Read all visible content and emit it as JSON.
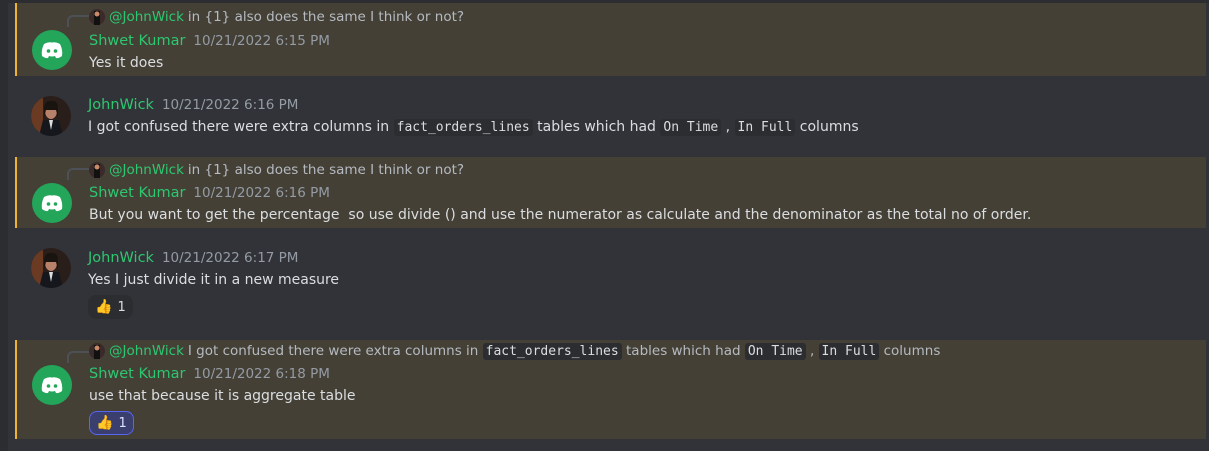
{
  "messages": [
    {
      "reply": {
        "mention": "@JohnWick",
        "text": "in {1} also does the same I think or not?"
      },
      "author": "Shwet Kumar",
      "timestamp": "10/21/2022 6:15 PM",
      "text": "Yes it does"
    },
    {
      "author": "JohnWick",
      "timestamp": "10/21/2022 6:16 PM",
      "parts": [
        "I got confused there were extra columns in",
        "fact_orders_lines",
        "tables which had",
        "On Time",
        ",",
        "In Full",
        "columns"
      ]
    },
    {
      "reply": {
        "mention": "@JohnWick",
        "text": "in {1} also does the same I think or not?"
      },
      "author": "Shwet Kumar",
      "timestamp": "10/21/2022 6:16 PM",
      "text": "But you want to get the percentage  so use divide () and use the numerator as calculate and the denominator as the total no of order."
    },
    {
      "author": "JohnWick",
      "timestamp": "10/21/2022 6:17 PM",
      "text": "Yes I just divide it in a new measure",
      "reaction": {
        "emoji": "thumbs-up",
        "count": "1"
      }
    },
    {
      "reply": {
        "mention": "@JohnWick",
        "parts": [
          "I got confused there were extra columns in",
          "fact_orders_lines",
          "tables which had",
          "On Time",
          ",",
          "In Full",
          "columns"
        ]
      },
      "author": "Shwet Kumar",
      "timestamp": "10/21/2022 6:18 PM",
      "text": "use that because it is aggregate table",
      "reaction": {
        "emoji": "thumbs-up",
        "count": "1"
      }
    }
  ],
  "colors": {
    "username": "#2dc770",
    "mention_bar": "#f0b232",
    "mention_bg": "#444036",
    "discord_green": "#23a55a"
  }
}
